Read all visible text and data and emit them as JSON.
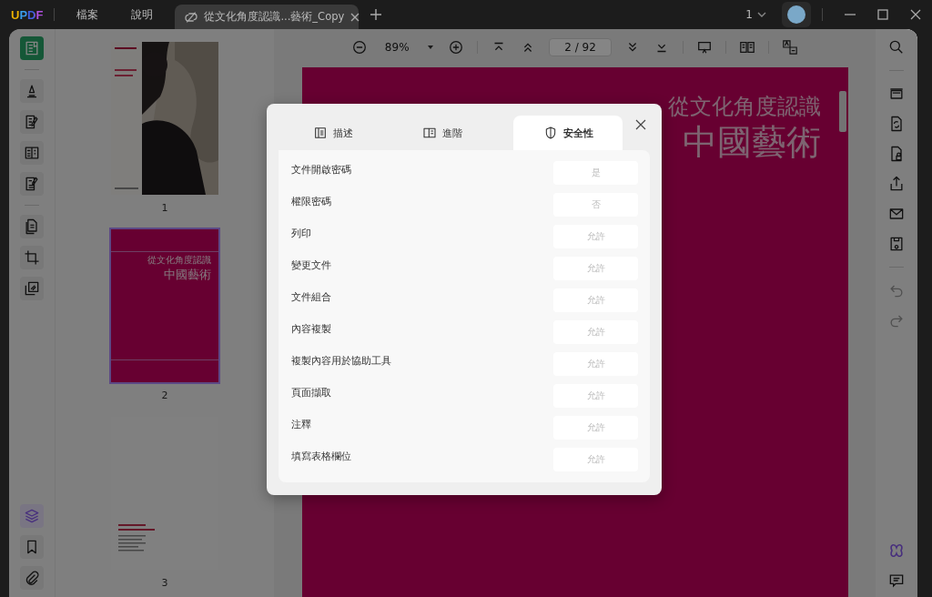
{
  "app": {
    "logo": "UPDF",
    "menu": [
      {
        "label": "檔案"
      },
      {
        "label": "說明"
      }
    ],
    "tab": {
      "title": "從文化角度認識...藝術_Copy"
    },
    "page_indicator": "1"
  },
  "left_rail": [
    {
      "items": [
        {
          "kind": "reader",
          "selected": true
        }
      ]
    },
    {
      "items": [
        {
          "kind": "highlight",
          "selected": false
        },
        {
          "kind": "edit",
          "selected": false
        },
        {
          "kind": "form",
          "selected": false
        },
        {
          "kind": "sign",
          "selected": false
        }
      ]
    },
    {
      "items": [
        {
          "kind": "organize",
          "selected": false
        },
        {
          "kind": "crop",
          "selected": false
        },
        {
          "kind": "watermark",
          "selected": false
        }
      ]
    }
  ],
  "left_rail_bottom": [
    {
      "kind": "layers",
      "selected": true
    },
    {
      "kind": "bookmark",
      "selected": false
    },
    {
      "kind": "attachment",
      "selected": false
    }
  ],
  "toolbar": {
    "zoom": "89%",
    "page_field": "2 / 92"
  },
  "thumbnails": [
    {
      "page_label": "1",
      "kind": "picture",
      "selected": false
    },
    {
      "page_label": "2",
      "kind": "cover",
      "title": "從文化角度認識",
      "subtitle": "中國藝術",
      "selected": true
    },
    {
      "page_label": "3",
      "kind": "text",
      "selected": false
    }
  ],
  "document": {
    "title": "從文化角度認識",
    "subtitle": "中國藝術"
  },
  "dialog": {
    "tabs": [
      {
        "label": "描述",
        "kind": "description",
        "selected": false
      },
      {
        "label": "進階",
        "kind": "advanced",
        "selected": false
      },
      {
        "label": "安全性",
        "kind": "security",
        "selected": true
      }
    ],
    "rows": [
      {
        "label": "文件開啟密碼",
        "value": "是"
      },
      {
        "label": "權限密碼",
        "value": "否"
      },
      {
        "label": "列印",
        "value": "允許"
      },
      {
        "label": "變更文件",
        "value": "允許"
      },
      {
        "label": "文件組合",
        "value": "允許"
      },
      {
        "label": "內容複製",
        "value": "允許"
      },
      {
        "label": "複製內容用於協助工具",
        "value": "允許"
      },
      {
        "label": "頁面擷取",
        "value": "允許"
      },
      {
        "label": "注釋",
        "value": "允許"
      },
      {
        "label": "填寫表格欄位",
        "value": "允許"
      }
    ]
  }
}
